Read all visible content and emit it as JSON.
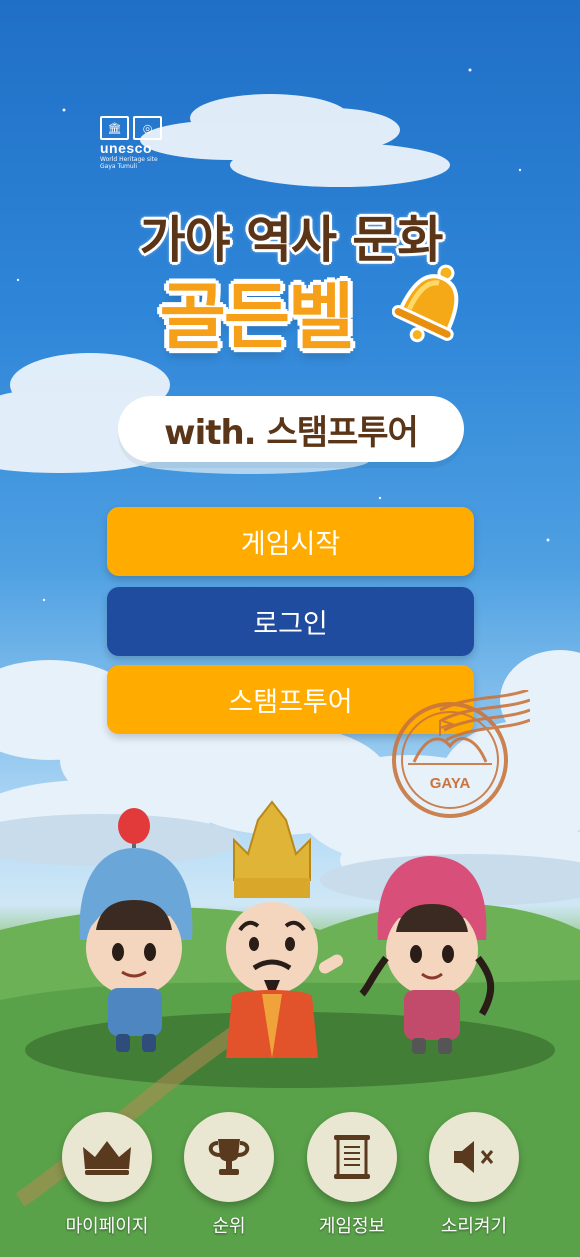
{
  "badge": {
    "org": "unesco",
    "line1": "World Heritage site",
    "line2": "Gaya Tumuli"
  },
  "logo": {
    "title_top": "가야 역사 문화",
    "title_main": "골든벨",
    "subtitle": "with. 스탬프투어"
  },
  "menu": {
    "start": "게임시작",
    "login": "로그인",
    "stamp_tour": "스탬프투어"
  },
  "stamp": {
    "text": "GAYA"
  },
  "bottom_nav": [
    {
      "label": "마이페이지",
      "icon": "crown-icon"
    },
    {
      "label": "순위",
      "icon": "trophy-icon"
    },
    {
      "label": "게임정보",
      "icon": "scroll-icon"
    },
    {
      "label": "소리켜기",
      "icon": "speaker-mute-icon"
    }
  ],
  "colors": {
    "orange": "#ffab00",
    "navy": "#1f4c9e",
    "brown": "#5b3518",
    "button_bg": "#e9e6d1"
  }
}
